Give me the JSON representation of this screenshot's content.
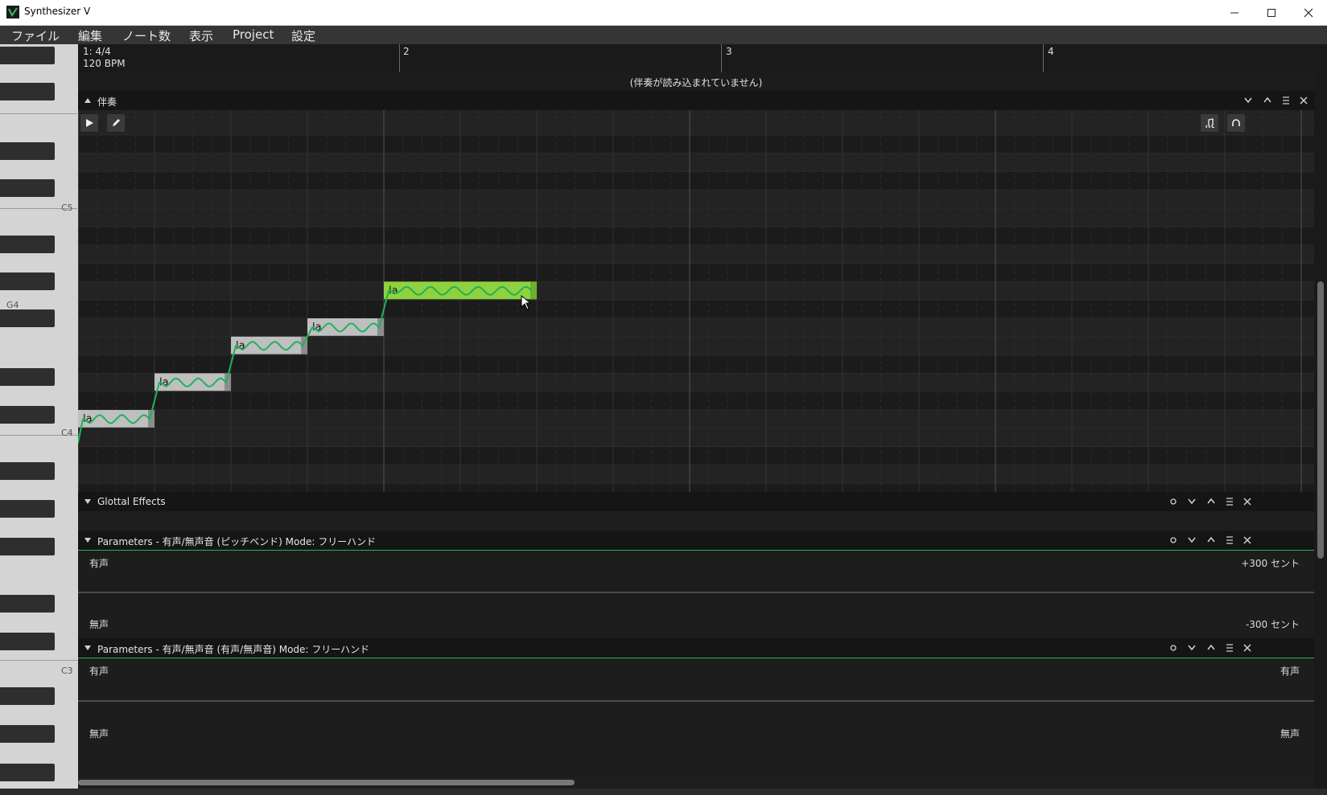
{
  "window": {
    "title": "Synthesizer V"
  },
  "menu": [
    "ファイル",
    "編集",
    "ノート数",
    "表示",
    "Project",
    "設定"
  ],
  "timeline": {
    "time_signature": "1: 4/4",
    "tempo": "120 BPM",
    "bar_labels": [
      "2",
      "3",
      "4"
    ]
  },
  "accompaniment": {
    "status": "(伴奏が読み込まれていません)",
    "label": "伴奏"
  },
  "piano": {
    "octave_labels": [
      "C5",
      "G4",
      "C4",
      "C3"
    ]
  },
  "notes": [
    {
      "lyric": "la",
      "pitch": "C4",
      "start": 0.0,
      "length": 0.5,
      "selected": false
    },
    {
      "lyric": "la",
      "pitch": "D4",
      "start": 0.5,
      "length": 0.5,
      "selected": false
    },
    {
      "lyric": "la",
      "pitch": "E4",
      "start": 1.0,
      "length": 0.5,
      "selected": false
    },
    {
      "lyric": "la",
      "pitch": "F4",
      "start": 1.5,
      "length": 0.5,
      "selected": false
    },
    {
      "lyric": "la",
      "pitch": "G4",
      "start": 2.0,
      "length": 1.0,
      "selected": true
    }
  ],
  "panels": {
    "glottal": {
      "title": "Glottal Effects"
    },
    "pitch_bend": {
      "title": "Parameters -  有声/無声音 (ピッチベンド) Mode: フリーハンド",
      "top_left": "有声",
      "bottom_left": "無声",
      "top_right": "+300 セント",
      "bottom_right": "-300 セント"
    },
    "voicing": {
      "title": "Parameters -  有声/無声音 (有声/無声音) Mode: フリーハンド",
      "top_left": "有声",
      "bottom_left": "無声",
      "top_right": "有声",
      "bottom_right": "無声"
    }
  },
  "colors": {
    "note_fill": "#bfbfbf",
    "note_selected": "#8fd13f",
    "pitch_curve": "#1fb25a",
    "background": "#202020"
  }
}
